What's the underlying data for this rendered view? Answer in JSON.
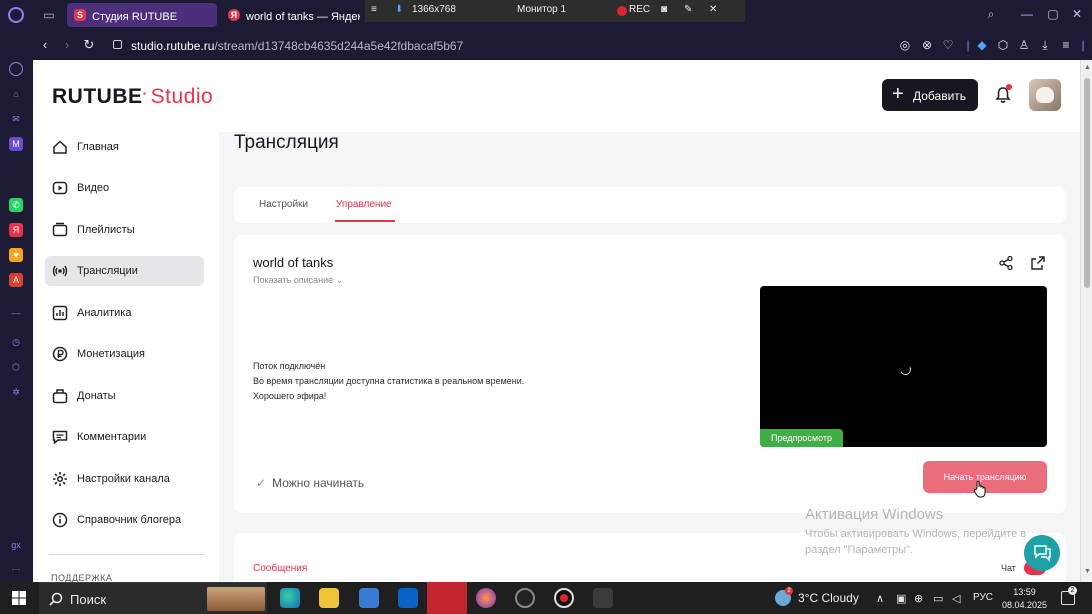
{
  "browser": {
    "tabs": [
      {
        "title": "Студия RUTUBE",
        "active": true,
        "favicon": "S"
      },
      {
        "title": "world of tanks — Яндекс",
        "active": false,
        "favicon": "Я"
      }
    ],
    "recorder": {
      "resolution": "1366x768",
      "monitor": "Монитор 1",
      "rec_label": "REC"
    },
    "url_host": "studio.rutube.ru",
    "url_path": "/stream/d13748cb4635d244a5e42fdbacaf5b67"
  },
  "header": {
    "logo_main": "RUTUBE",
    "logo_studio": "Studio",
    "add_label": "Добавить"
  },
  "sidebar": {
    "items": [
      {
        "label": "Главная",
        "icon": "home-icon"
      },
      {
        "label": "Видео",
        "icon": "video-icon"
      },
      {
        "label": "Плейлисты",
        "icon": "playlist-icon"
      },
      {
        "label": "Трансляции",
        "icon": "broadcast-icon",
        "active": true
      },
      {
        "label": "Аналитика",
        "icon": "analytics-icon"
      },
      {
        "label": "Монетизация",
        "icon": "ruble-icon"
      },
      {
        "label": "Донаты",
        "icon": "donate-icon"
      },
      {
        "label": "Комментарии",
        "icon": "comments-icon"
      },
      {
        "label": "Настройки канала",
        "icon": "gear-icon"
      },
      {
        "label": "Справочник блогера",
        "icon": "info-icon"
      }
    ],
    "support_label": "ПОДДЕРЖКА"
  },
  "main": {
    "page_title": "Трансляция",
    "tabs": [
      {
        "label": "Настройки",
        "active": false
      },
      {
        "label": "Управление",
        "active": true
      }
    ],
    "stream": {
      "title": "world of tanks",
      "show_description": "Показать описание",
      "status_line1": "Поток подключён",
      "status_line2": "Во время трансляции доступна статистика в реальном времени.",
      "status_line3": "Хорошего эфира!",
      "preview_badge": "Предпросмотр",
      "ready_label": "Можно начинать",
      "start_label": "Начать трансляцию"
    },
    "messages": {
      "title": "Сообщения",
      "chat_label": "Чат"
    }
  },
  "watermark": {
    "title": "Активация Windows",
    "line1": "Чтобы активировать Windows, перейдите в",
    "line2": "раздел \"Параметры\"."
  },
  "taskbar": {
    "search_placeholder": "Поиск",
    "weather": "3°C Cloudy",
    "weather_badge": "2",
    "language": "РУС",
    "time": "13:59",
    "date": "08.04.2025",
    "notifications": "2"
  },
  "colors": {
    "accent": "#e8334a",
    "start_button": "#ea6d7b",
    "preview_badge": "#3fae45",
    "dark_button": "#16181f"
  }
}
